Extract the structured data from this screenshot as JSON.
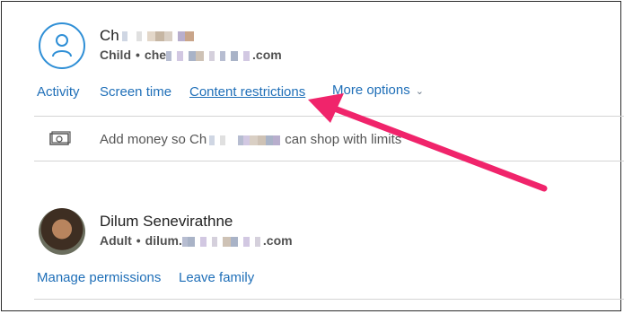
{
  "child": {
    "name_prefix": "Ch",
    "role": "Child",
    "email_prefix": "che",
    "email_suffix": ".com"
  },
  "tabs": {
    "activity": "Activity",
    "screen_time": "Screen time",
    "content_restrictions": "Content restrictions",
    "more_options": "More options"
  },
  "money": {
    "text_prefix": "Add money so Ch",
    "text_suffix": "can shop with  limits"
  },
  "adult": {
    "name": "Dilum Senevirathne",
    "role": "Adult",
    "email_prefix": "dilum.",
    "email_suffix": ".com"
  },
  "adult_links": {
    "manage_permissions": "Manage permissions",
    "leave_family": "Leave family"
  },
  "colors": {
    "link": "#1f6fb8",
    "avatar_ring": "#2f8fd6",
    "annotation_arrow": "#f0246b"
  },
  "icons": {
    "child_avatar": "person-outline-icon",
    "money": "money-bill-icon",
    "more_options_chevron": "chevron-down-icon",
    "annotation": "arrow-annotation-icon"
  }
}
